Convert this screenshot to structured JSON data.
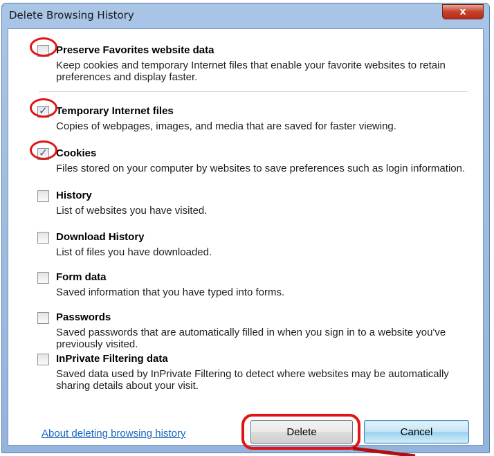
{
  "window": {
    "title": "Delete Browsing History",
    "close_label": "x"
  },
  "options": [
    {
      "title": "Preserve Favorites website data",
      "description": "Keep cookies and temporary Internet files that enable your favorite websites to retain preferences and display faster.",
      "checked": false,
      "highlighted": true
    },
    {
      "title": "Temporary Internet files",
      "description": "Copies of webpages, images, and media that are saved for faster viewing.",
      "checked": true,
      "highlighted": true
    },
    {
      "title": "Cookies",
      "description": "Files stored on your computer by websites to save preferences such as login information.",
      "checked": true,
      "highlighted": true
    },
    {
      "title": "History",
      "description": "List of websites you have visited.",
      "checked": false,
      "highlighted": false
    },
    {
      "title": "Download History",
      "description": "List of files you have downloaded.",
      "checked": false,
      "highlighted": false
    },
    {
      "title": "Form data",
      "description": "Saved information that you have typed into forms.",
      "checked": false,
      "highlighted": false
    },
    {
      "title": "Passwords",
      "description": "Saved passwords that are automatically filled in when you sign in to a website you've previously visited.",
      "checked": false,
      "highlighted": false
    },
    {
      "title": "InPrivate Filtering data",
      "description": "Saved data used by InPrivate Filtering to detect where websites may be automatically sharing details about your visit.",
      "checked": false,
      "highlighted": false
    }
  ],
  "footer": {
    "help_link": "About deleting browsing history",
    "delete_label": "Delete",
    "cancel_label": "Cancel"
  },
  "colors": {
    "highlight": "#e01414",
    "link": "#1565c0",
    "check": "#3a52a3"
  },
  "icons": {
    "close": "close-icon",
    "check": "checkmark-icon"
  }
}
